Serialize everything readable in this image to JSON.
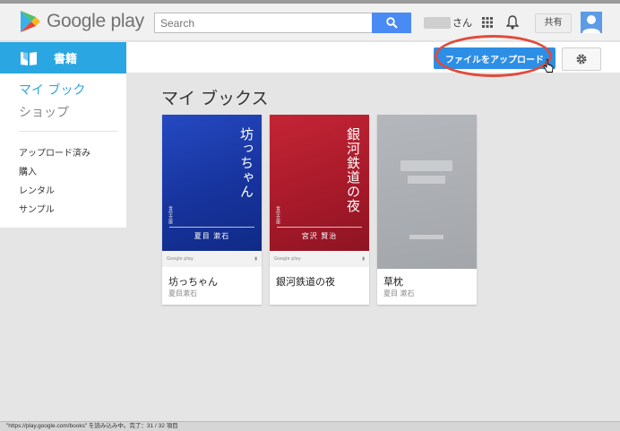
{
  "header": {
    "logo_text": "Google play",
    "search_placeholder": "Search",
    "user_suffix": "さん",
    "share_label": "共有"
  },
  "subbar": {
    "section_label": "書籍",
    "upload_label": "ファイルをアップロード"
  },
  "sidebar": {
    "main_items": [
      "マイ ブック",
      "ショップ"
    ],
    "sub_items": [
      "アップロード済み",
      "購入",
      "レンタル",
      "サンプル"
    ]
  },
  "main": {
    "title": "マイ ブックス",
    "books": [
      {
        "title": "坊っちゃん",
        "author": "夏目漱石",
        "cover_title": "坊っちゃん",
        "cover_author": "夏目 漱石",
        "publisher": "青空文庫",
        "color": "#1a3fae"
      },
      {
        "title": "銀河鉄道の夜",
        "author": "",
        "cover_title": "銀河鉄道の夜",
        "cover_author": "宮沢 賢治",
        "publisher": "青空文庫",
        "color": "#b01e2e"
      },
      {
        "title": "草枕",
        "author": "夏目 漱石",
        "color": "#a9acb0"
      }
    ],
    "cover_footer_brand": "Google play"
  },
  "status": {
    "text": "\"https://play.google.com/books\" を読み込み中。完了：31 / 32 項目"
  },
  "colors": {
    "brand_blue": "#2aa7e2",
    "upload_blue": "#2d8ee6",
    "annotation_red": "#e14b3b"
  }
}
